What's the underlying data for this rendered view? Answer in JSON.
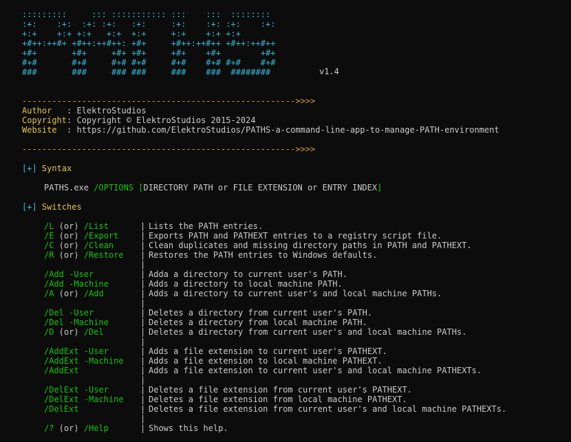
{
  "banner": {
    "ascii": ":::::::::     ::: ::::::::::: :::    :::  :::::::: \n:+:    :+:  :+: :+:   :+:     :+:    :+: :+:    :+:\n+:+    +:+ +:+   +:+  +:+     +:+    +:+ +:+       \n+#++:++#+ +#++:++#++: +#+     +#++:++#++ +#++:++#++\n+#+       +#+     +#+ +#+     +#+    +#+        +#+\n#+#       #+#     #+# #+#     #+#    #+# #+#    #+#\n###       ###     ### ###     ###    ###  ######## ",
    "version": "v1.4"
  },
  "separator": "------------------------------------------------------->>>>",
  "info": [
    {
      "key": "Author   ",
      "value": ": ElektroStudios"
    },
    {
      "key": "Copyright",
      "value": ": Copyright © ElektroStudios 2015-2024"
    },
    {
      "key": "Website  ",
      "value": ": https://github.com/ElektroStudios/PATHS-a-command-line-app-to-manage-PATH-environment"
    }
  ],
  "syntax": {
    "marker": "[+]",
    "title": "Syntax",
    "exe": "PATHS.exe",
    "options": "/OPTIONS",
    "open_bracket": "[",
    "args": "DIRECTORY PATH or FILE EXTENSION or ENTRY INDEX",
    "close_bracket": "]"
  },
  "switches": {
    "marker": "[+]",
    "title": "Switches",
    "bar": "|",
    "rows": [
      {
        "parts": [
          {
            "t": "/L",
            "c": "g"
          },
          {
            "t": " (or) ",
            "c": "w"
          },
          {
            "t": "/List",
            "c": "g"
          }
        ],
        "desc": "Lists the PATH entries."
      },
      {
        "parts": [
          {
            "t": "/E",
            "c": "g"
          },
          {
            "t": " (or) ",
            "c": "w"
          },
          {
            "t": "/Export",
            "c": "g"
          }
        ],
        "desc": "Exports PATH and PATHEXT entries to a registry script file."
      },
      {
        "parts": [
          {
            "t": "/C",
            "c": "g"
          },
          {
            "t": " (or) ",
            "c": "w"
          },
          {
            "t": "/Clean",
            "c": "g"
          }
        ],
        "desc": "Clean duplicates and missing directory paths in PATH and PATHEXT."
      },
      {
        "parts": [
          {
            "t": "/R",
            "c": "g"
          },
          {
            "t": " (or) ",
            "c": "w"
          },
          {
            "t": "/Restore",
            "c": "g"
          }
        ],
        "desc": "Restores the PATH entries to Windows defaults."
      },
      {
        "parts": [
          {
            "t": "/Add -User",
            "c": "g"
          }
        ],
        "desc": "Adda a directory to current user's PATH."
      },
      {
        "parts": [
          {
            "t": "/Add -Machine",
            "c": "g"
          }
        ],
        "desc": "Adds a directory to local machine PATH."
      },
      {
        "parts": [
          {
            "t": "/A",
            "c": "g"
          },
          {
            "t": " (or) ",
            "c": "w"
          },
          {
            "t": "/Add",
            "c": "g"
          }
        ],
        "desc": "Adds a directory to current user's and local machine PATHs."
      },
      {
        "parts": [
          {
            "t": "/Del -User",
            "c": "g"
          }
        ],
        "desc": "Deletes a directory from current user's PATH."
      },
      {
        "parts": [
          {
            "t": "/Del -Machine",
            "c": "g"
          }
        ],
        "desc": "Deletes a directory from local machine PATH."
      },
      {
        "parts": [
          {
            "t": "/D",
            "c": "g"
          },
          {
            "t": " (or) ",
            "c": "w"
          },
          {
            "t": "/Del",
            "c": "g"
          }
        ],
        "desc": "Deletes a directory from current user's and local machine PATHs."
      },
      {
        "parts": [
          {
            "t": "/AddExt -User",
            "c": "g"
          }
        ],
        "desc": "Adds a file extension to current user's PATHEXT."
      },
      {
        "parts": [
          {
            "t": "/AddExt -Machine",
            "c": "g"
          }
        ],
        "desc": "Adds a file extension to local machine PATHEXT."
      },
      {
        "parts": [
          {
            "t": "/AddExt",
            "c": "g"
          }
        ],
        "desc": "Adds a file extension to current user's and local machine PATHEXTs."
      },
      {
        "parts": [
          {
            "t": "/DelExt -User",
            "c": "g"
          }
        ],
        "desc": "Deletes a file extension from current user's PATHEXT."
      },
      {
        "parts": [
          {
            "t": "/DelExt -Machine",
            "c": "g"
          }
        ],
        "desc": "Deletes a file extension from local machine PATHEXT."
      },
      {
        "parts": [
          {
            "t": "/DelExt",
            "c": "g"
          }
        ],
        "desc": "Deletes a file extension from current user's and local machine PATHEXTs."
      },
      {
        "parts": [
          {
            "t": "/?",
            "c": "g"
          },
          {
            "t": " (or) ",
            "c": "w"
          },
          {
            "t": "/Help",
            "c": "g"
          }
        ],
        "desc": "Shows this help."
      }
    ]
  },
  "colors": {
    "background": "#0c0c0c",
    "text": "#cccccc",
    "yellow": "#e3c451",
    "cyan": "#3ab7d6",
    "green": "#16c60c",
    "separator": "#d7a34a"
  }
}
